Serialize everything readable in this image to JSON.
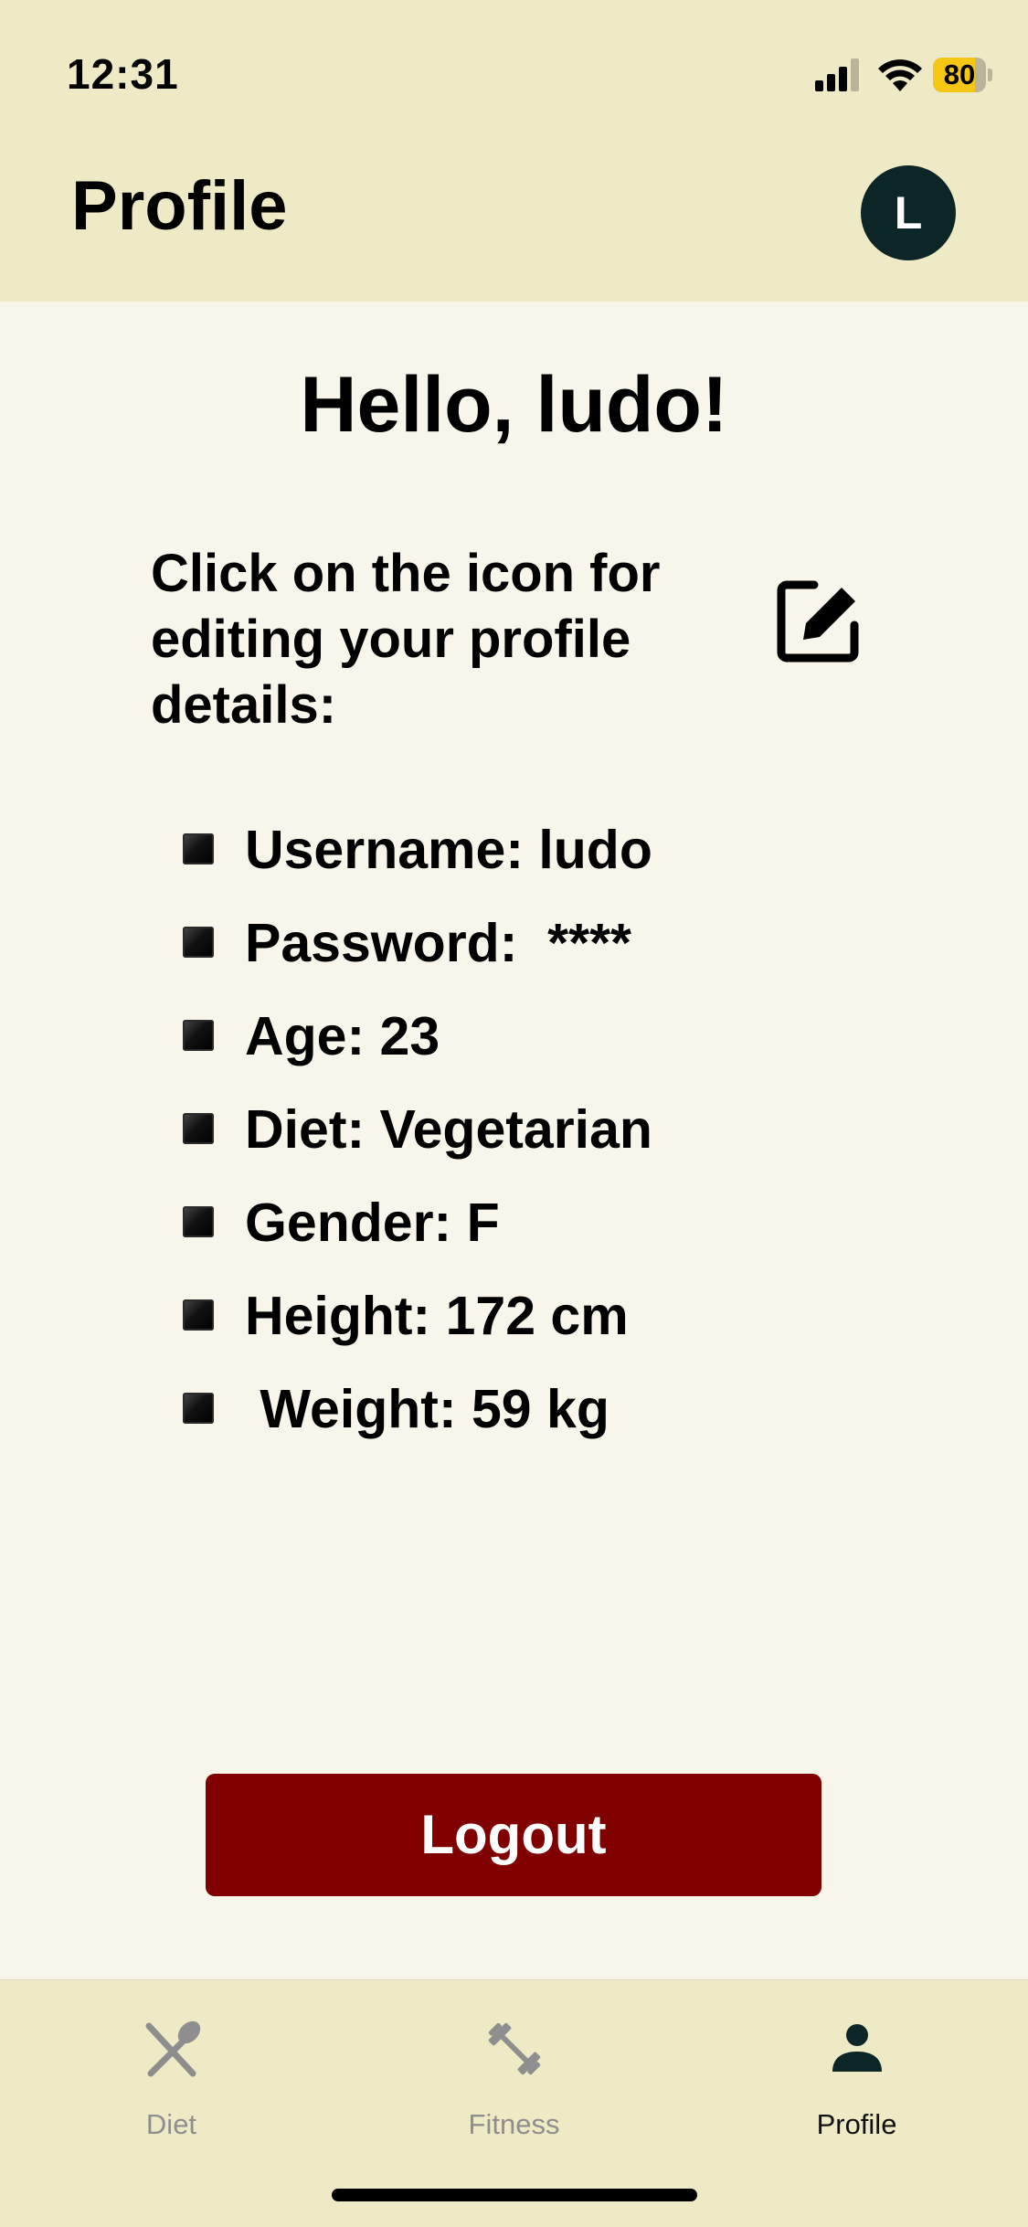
{
  "status_bar": {
    "time": "12:31",
    "battery_percent": "80",
    "battery_level": 0.8,
    "icons": [
      "cellular-signal-icon",
      "wifi-icon",
      "battery-icon"
    ]
  },
  "header": {
    "title": "Profile",
    "avatar_initial": "L"
  },
  "main": {
    "greeting": "Hello, ludo!",
    "instruction": "Click on the icon for editing your profile details:",
    "edit_icon": "edit-icon",
    "details": [
      "Username: ludo",
      "Password:  ****",
      "Age: 23",
      "Diet: Vegetarian",
      "Gender: F",
      "Height: 172 cm",
      " Weight: 59 kg"
    ],
    "logout_label": "Logout"
  },
  "tabs": [
    {
      "label": "Diet",
      "icon": "utensils-icon",
      "active": false
    },
    {
      "label": "Fitness",
      "icon": "dumbbell-icon",
      "active": false
    },
    {
      "label": "Profile",
      "icon": "person-icon",
      "active": true
    }
  ],
  "colors": {
    "header_bg": "#eeeac6",
    "page_bg": "#f8f6ea",
    "avatar_bg": "#0c2628",
    "logout_bg": "#800000",
    "battery_fill": "#f6c614",
    "tab_active": "#0c2628",
    "tab_inactive": "#8e8e8e"
  }
}
